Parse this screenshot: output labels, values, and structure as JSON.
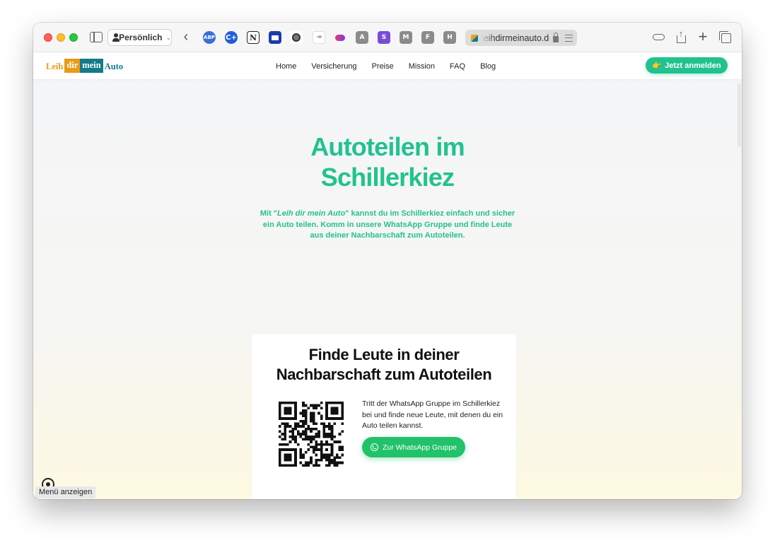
{
  "browser": {
    "profile_label": "Persönlich",
    "url": "leihdirmeinauto.de",
    "extensions": [
      {
        "name": "adblock-plus-icon",
        "label": "ABP"
      },
      {
        "name": "c-plus-icon",
        "label": "C+"
      },
      {
        "name": "notion-icon",
        "label": "N"
      },
      {
        "name": "book-icon",
        "label": ""
      },
      {
        "name": "record-icon",
        "label": ""
      },
      {
        "name": "page-icon",
        "label": ""
      },
      {
        "name": "cloud-extension-icon",
        "label": ""
      },
      {
        "name": "a-extension-icon",
        "label": "A"
      },
      {
        "name": "s-extension-icon",
        "label": "S"
      },
      {
        "name": "m-extension-icon",
        "label": "M"
      },
      {
        "name": "f-extension-icon",
        "label": "F"
      },
      {
        "name": "h-extension-icon",
        "label": "H"
      }
    ]
  },
  "site": {
    "logo": {
      "part1": "Leih",
      "part2": "dir",
      "part3": "mein",
      "part4": "Auto"
    },
    "nav": [
      "Home",
      "Versicherung",
      "Preise",
      "Mission",
      "FAQ",
      "Blog"
    ],
    "cta_icon": "👉",
    "cta_label": "Jetzt anmelden",
    "colors": {
      "accent": "#22c28f",
      "logo_orange": "#e89b17",
      "logo_teal": "#137a8a",
      "whatsapp": "#22c26a"
    }
  },
  "hero": {
    "title_line1": "Autoteilen im",
    "title_line2": "Schillerkiez",
    "subtitle_prefix": "Mit \"",
    "subtitle_brand": "Leih dir mein Auto",
    "subtitle_suffix": "\" kannst du im Schillerkiez einfach und sicher ein Auto teilen. Komm in unsere WhatsApp Gruppe und finde Leute aus deiner Nachbarschaft zum Autoteilen."
  },
  "card": {
    "title_line1": "Finde Leute in deiner",
    "title_line2": "Nachbarschaft zum Autoteilen",
    "text": "Tritt der WhatsApp Gruppe im Schillerkiez bei und finde neue Leute, mit denen du ein Auto teilen kannst.",
    "button_label": "Zur WhatsApp Gruppe"
  },
  "overlay": {
    "menu_label": "Menü anzeigen"
  }
}
